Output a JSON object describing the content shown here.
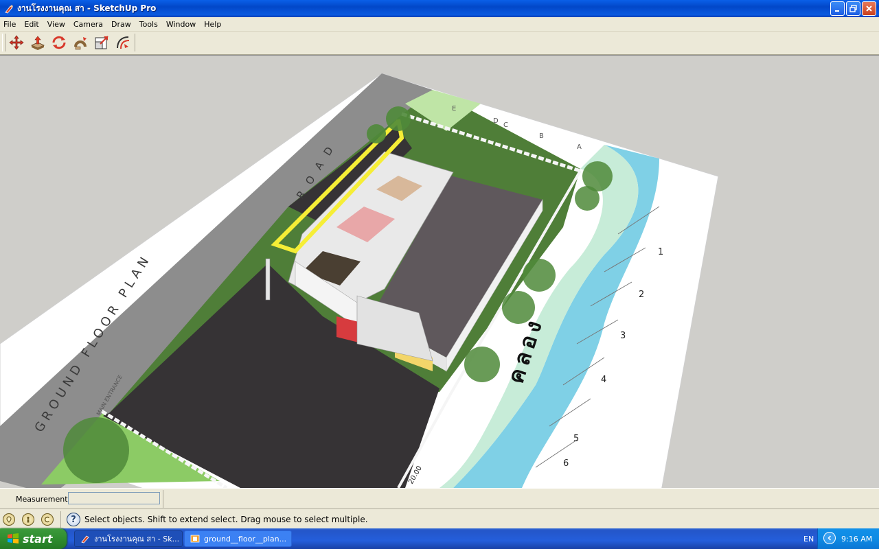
{
  "window": {
    "title": "งานโรงงานคุณ สา - SketchUp Pro",
    "minimize_label": "minimize",
    "restore_label": "restore",
    "close_label": "close"
  },
  "menu": {
    "items": [
      "File",
      "Edit",
      "View",
      "Camera",
      "Draw",
      "Tools",
      "Window",
      "Help"
    ]
  },
  "toolbar": {
    "tools": [
      {
        "name": "move-icon",
        "tooltip": "Move"
      },
      {
        "name": "push-pull-icon",
        "tooltip": "Push/Pull"
      },
      {
        "name": "rotate-icon",
        "tooltip": "Rotate"
      },
      {
        "name": "follow-me-icon",
        "tooltip": "Follow Me"
      },
      {
        "name": "scale-icon",
        "tooltip": "Scale"
      },
      {
        "name": "offset-icon",
        "tooltip": "Offset"
      }
    ]
  },
  "viewport": {
    "labels": {
      "road": "ROAD",
      "plan_title": "GROUND FLOOR PLAN",
      "main_entrance": "MAIN ENTRANCE",
      "canal": "คลอง",
      "grid_letters": [
        "E",
        "D",
        "C",
        "B",
        "A"
      ],
      "grid_numbers": [
        "1",
        "2",
        "3",
        "4",
        "5",
        "6"
      ],
      "dimension_text": "20.00"
    },
    "colors": {
      "background": "#cfceca",
      "road": "#8d8d8d",
      "lawn": "#4f7e38",
      "water": "#7fd0e6",
      "asphalt": "#363335",
      "roof": "#5f585c",
      "selection": "#f6ee36",
      "paper": "#ffffff"
    }
  },
  "measurements": {
    "label": "Measurements",
    "value": ""
  },
  "status": {
    "text": "Select objects. Shift to extend select. Drag mouse to select multiple.",
    "icons": [
      "geo-location-icon",
      "credits-icon",
      "instructor-icon"
    ],
    "help_symbol": "?"
  },
  "taskbar": {
    "start_label": "start",
    "tasks": [
      {
        "label": "งานโรงงานคุณ สา - Sk...",
        "active": true
      },
      {
        "label": "ground__floor__plan...",
        "active": false
      }
    ],
    "language": "EN",
    "time": "9:16 AM"
  }
}
